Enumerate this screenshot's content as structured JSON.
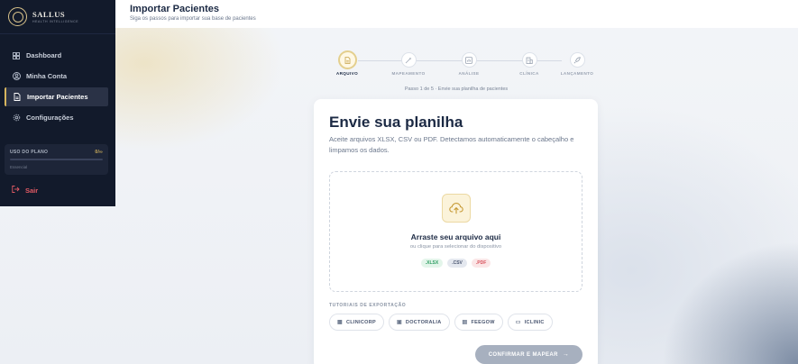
{
  "brand": {
    "name": "SALLUS",
    "tagline": "HEALTH INTELLIGENCE"
  },
  "sidebar": {
    "items": [
      {
        "label": "Dashboard",
        "icon": "grid-icon"
      },
      {
        "label": "Minha Conta",
        "icon": "user-circle-icon"
      },
      {
        "label": "Importar Pacientes",
        "icon": "file-icon",
        "active": true
      },
      {
        "label": "Configurações",
        "icon": "gear-icon"
      }
    ],
    "plan": {
      "label": "USO DO PLANO",
      "value": "0/∞",
      "tier": "Essencial",
      "usage_fraction": 0
    },
    "logout": "Sair"
  },
  "header": {
    "title": "Importar Pacientes",
    "subtitle": "Siga os passos para importar sua base de pacientes"
  },
  "stepper": {
    "steps": [
      {
        "label": "ARQUIVO",
        "icon": "file-icon",
        "active": true
      },
      {
        "label": "MAPEAMENTO",
        "icon": "wand-icon"
      },
      {
        "label": "ANÁLISE",
        "icon": "chart-icon"
      },
      {
        "label": "CLÍNICA",
        "icon": "building-icon"
      },
      {
        "label": "LANÇAMENTO",
        "icon": "rocket-icon"
      }
    ],
    "caption": "Passo 1 de 5 · Envie sua planilha de pacientes"
  },
  "card": {
    "title": "Envie sua planilha",
    "description": "Aceite arquivos XLSX, CSV ou PDF. Detectamos automaticamente o cabeçalho e limpamos os dados.",
    "dropzone": {
      "icon": "cloud-upload-icon",
      "title": "Arraste seu arquivo aqui",
      "subtitle": "ou clique para selecionar do dispositivo",
      "formats": [
        ".XLSX",
        ".CSV",
        ".PDF"
      ]
    },
    "tutorials_title": "TUTORIAIS DE EXPORTAÇÃO",
    "tutorials": [
      "CLINICORP",
      "DOCTORALIA",
      "FEEGOW",
      "ICLINIC"
    ],
    "confirm_label": "CONFIRMAR E MAPEAR"
  },
  "colors": {
    "sidebar_bg": "#121a2b",
    "accent_gold": "#d6b55e",
    "logout_red": "#e25a64",
    "confirm_disabled": "#a7b0bf"
  }
}
